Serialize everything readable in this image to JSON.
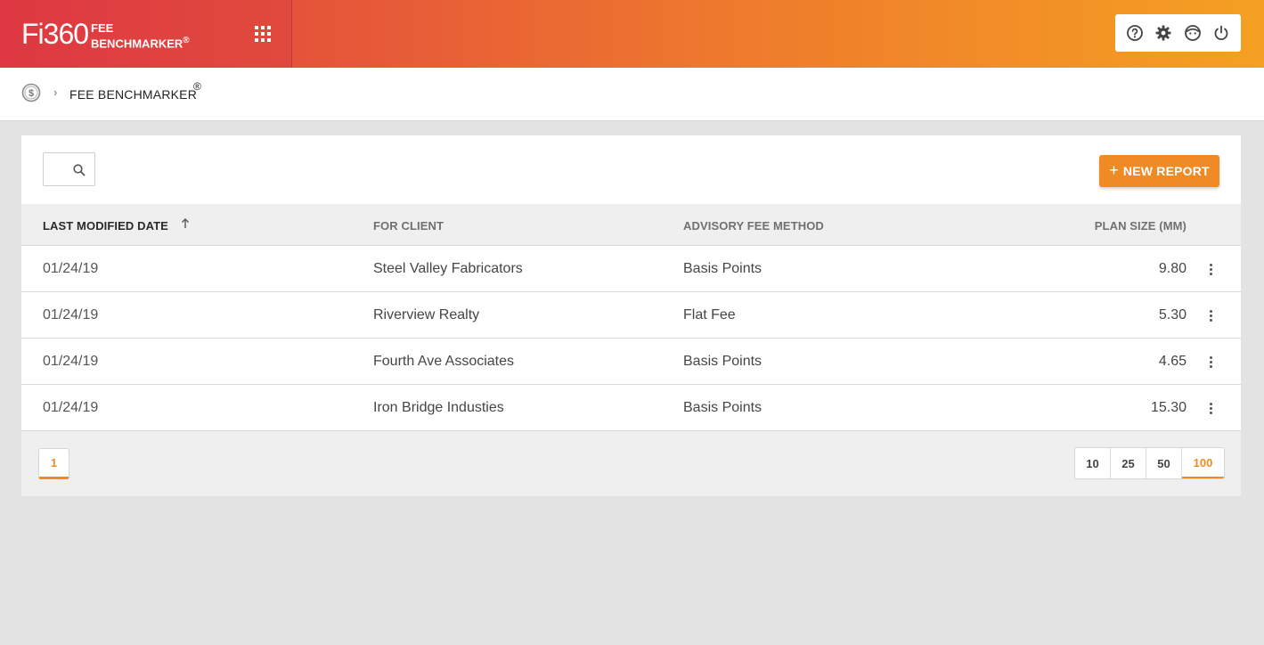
{
  "header": {
    "logo_text": "Fi360",
    "app_title_line1": "FEE",
    "app_title_line2": "BENCHMARKER",
    "app_title_reg": "®",
    "gradient_start": "#e13e3f",
    "gradient_end": "#f4a022",
    "tools": [
      "help-icon",
      "settings-icon",
      "user-icon",
      "power-icon"
    ]
  },
  "breadcrumb": {
    "icon": "dollar-circle-icon",
    "separator": "›",
    "label": "FEE BENCHMARKER",
    "reg": "®"
  },
  "toolbar": {
    "search_value": "",
    "new_report_plus": "+",
    "new_report_label": "NEW REPORT",
    "accent_color": "#f08a24"
  },
  "table": {
    "columns": [
      "LAST MODIFIED DATE",
      "FOR CLIENT",
      "ADVISORY FEE METHOD",
      "PLAN SIZE (MM)"
    ],
    "sort_column": "LAST MODIFIED DATE",
    "sort_direction": "ascending",
    "rows": [
      {
        "date": "01/24/19",
        "client": "Steel Valley Fabricators",
        "method": "Basis Points",
        "size": "9.80"
      },
      {
        "date": "01/24/19",
        "client": "Riverview Realty",
        "method": "Flat Fee",
        "size": "5.30"
      },
      {
        "date": "01/24/19",
        "client": "Fourth Ave Associates",
        "method": "Basis Points",
        "size": "4.65"
      },
      {
        "date": "01/24/19",
        "client": "Iron Bridge Industies",
        "method": "Basis Points",
        "size": "15.30"
      }
    ]
  },
  "pagination": {
    "current_page": "1",
    "page_sizes": [
      "10",
      "25",
      "50",
      "100"
    ],
    "selected_page_size": "100"
  }
}
